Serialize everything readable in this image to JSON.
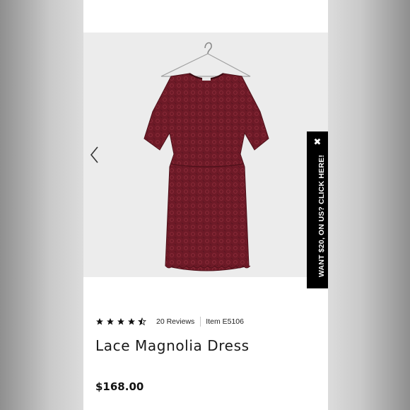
{
  "promo": {
    "text": "WANT $20, ON US? CLICK HERE!",
    "close_glyph": "✖"
  },
  "product": {
    "rating": 4.5,
    "rating_max": 5,
    "reviews_label": "20 Reviews",
    "item_label": "Item E5106",
    "name": "Lace Magnolia Dress",
    "price": "$168.00",
    "dress_color": "#6e1a27"
  },
  "icons": {
    "prev": "chevron-left-icon",
    "star": "star-icon"
  }
}
